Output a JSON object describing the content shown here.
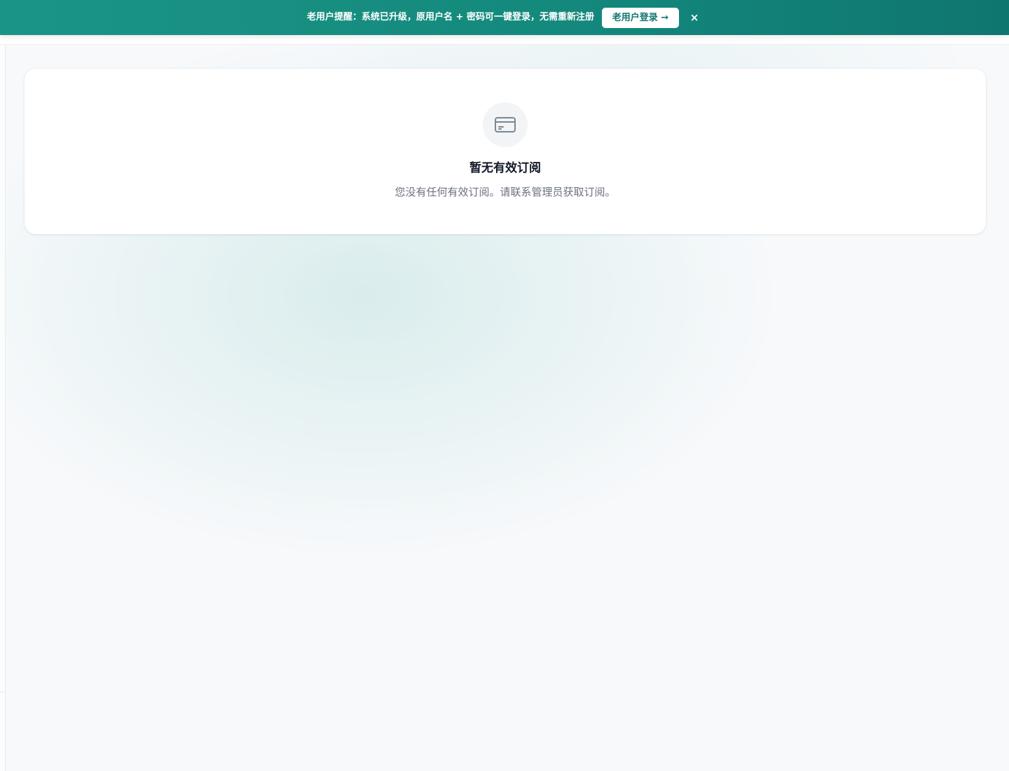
{
  "banner": {
    "message": "老用户提醒：系统已升级，原用户名 + 密码可一键登录，无需重新注册",
    "button_label": "老用户登录 →",
    "close_label": "×"
  },
  "empty_state": {
    "icon": "credit-card-icon",
    "title": "暂无有效订阅",
    "description": "您没有任何有效订阅。请联系管理员获取订阅。"
  },
  "colors": {
    "banner_gradient_start": "#1a9585",
    "banner_gradient_end": "#0f766e",
    "button_text": "#0f766e",
    "title_text": "#111827",
    "description_text": "#6b7280"
  }
}
